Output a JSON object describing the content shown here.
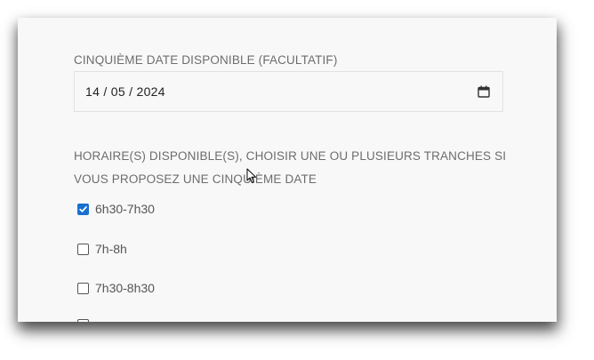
{
  "form": {
    "date_label": "CINQUIÈME DATE DISPONIBLE (FACULTATIF)",
    "date_value": "14 / 05 / 2024",
    "hours_label": "HORAIRE(S) DISPONIBLE(S), CHOISIR UNE OU PLUSIEURS TRANCHES SI VOUS PROPOSEZ UNE CINQUIÈME DATE",
    "options": [
      {
        "label": "6h30-7h30",
        "checked": true
      },
      {
        "label": "7h-8h",
        "checked": false
      },
      {
        "label": "7h30-8h30",
        "checked": false
      },
      {
        "label": "",
        "checked": false
      }
    ]
  },
  "colors": {
    "card_bg": "#f8f8f8",
    "label_text": "#6d6d6d",
    "checkbox_checked": "#1a6fd1"
  },
  "icons": {
    "date_picker": "calendar-icon",
    "checked": "checkmark-icon",
    "pointer": "mouse-cursor-icon"
  }
}
